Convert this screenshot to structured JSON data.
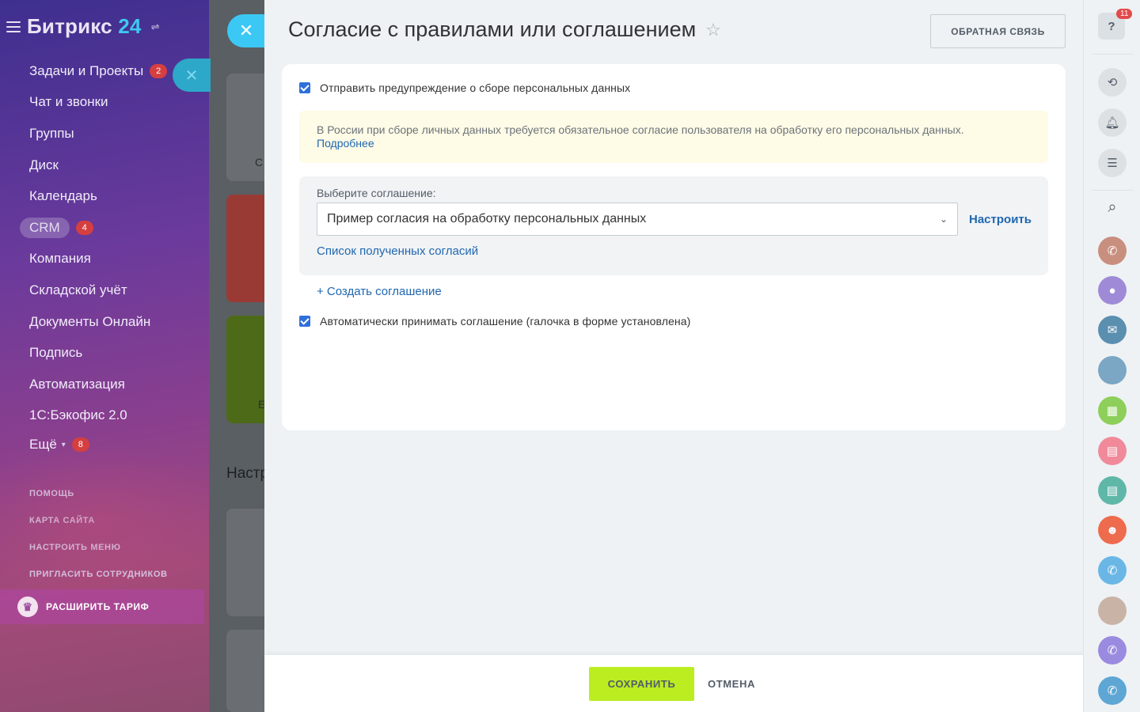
{
  "sidebar": {
    "logo_main": "Битрикс",
    "logo_num": "24",
    "items": [
      {
        "label": "Задачи и Проекты",
        "count": "2"
      },
      {
        "label": "Чат и звонки"
      },
      {
        "label": "Группы"
      },
      {
        "label": "Диск"
      },
      {
        "label": "Календарь"
      },
      {
        "label": "CRM",
        "count": "4"
      },
      {
        "label": "Компания"
      },
      {
        "label": "Складской учёт"
      },
      {
        "label": "Документы Онлайн"
      },
      {
        "label": "Подпись"
      },
      {
        "label": "Автоматизация"
      },
      {
        "label": "1С:Бэкофис 2.0"
      },
      {
        "label": "Ещё",
        "count": "8"
      }
    ],
    "sub_links": [
      "ПОМОЩЬ",
      "КАРТА САЙТА",
      "НАСТРОИТЬ МЕНЮ",
      "ПРИГЛАСИТЬ СОТРУДНИКОВ"
    ],
    "upgrade_label": "РАСШИРИТЬ ТАРИФ"
  },
  "background": {
    "section_title": "Настр",
    "card_letters": [
      "С",
      "Е"
    ]
  },
  "panel": {
    "title": "Согласие с правилами или соглашением",
    "feedback_label": "ОБРАТНАЯ СВЯЗЬ",
    "warn_checkbox_label": "Отправить предупреждение о сборе персональных данных",
    "warn_checked": true,
    "notice_text": "В России при сборе личных данных требуется обязательное согласие пользователя на обработку его персональных данных.",
    "notice_link": "Подробнее",
    "select_label": "Выберите соглашение:",
    "select_value": "Пример согласия на обработку персональных данных",
    "configure_label": "Настроить",
    "consents_list_link": "Список полученных согласий",
    "create_link": "+ Создать соглашение",
    "auto_checkbox_label": "Автоматически принимать соглашение (галочка в форме установлена)",
    "auto_checked": true
  },
  "footer": {
    "save_label": "СОХРАНИТЬ",
    "cancel_label": "ОТМЕНА"
  },
  "rightbar": {
    "help_icon": "?",
    "help_badge": "11",
    "colors": {
      "phone_brown": "#c98f7e",
      "user_purple": "#9f8ad8",
      "group_blue": "#5b8fb0",
      "calendar_green": "#8dcf5a",
      "card_pink": "#f08a9a",
      "card_teal": "#5fb7a8",
      "people_orange": "#ee6b4e",
      "phone_lightblue": "#6ab7e6",
      "phone_violet": "#9a8be0",
      "phone_steelblue": "#5ea6d4"
    }
  },
  "colors": {
    "accent_blue": "#2067b0",
    "save_green": "#bbed21",
    "close_cyan": "#3bc8f5",
    "checkbox_blue": "#2f6fdb",
    "counter_red": "#d53f3f"
  }
}
